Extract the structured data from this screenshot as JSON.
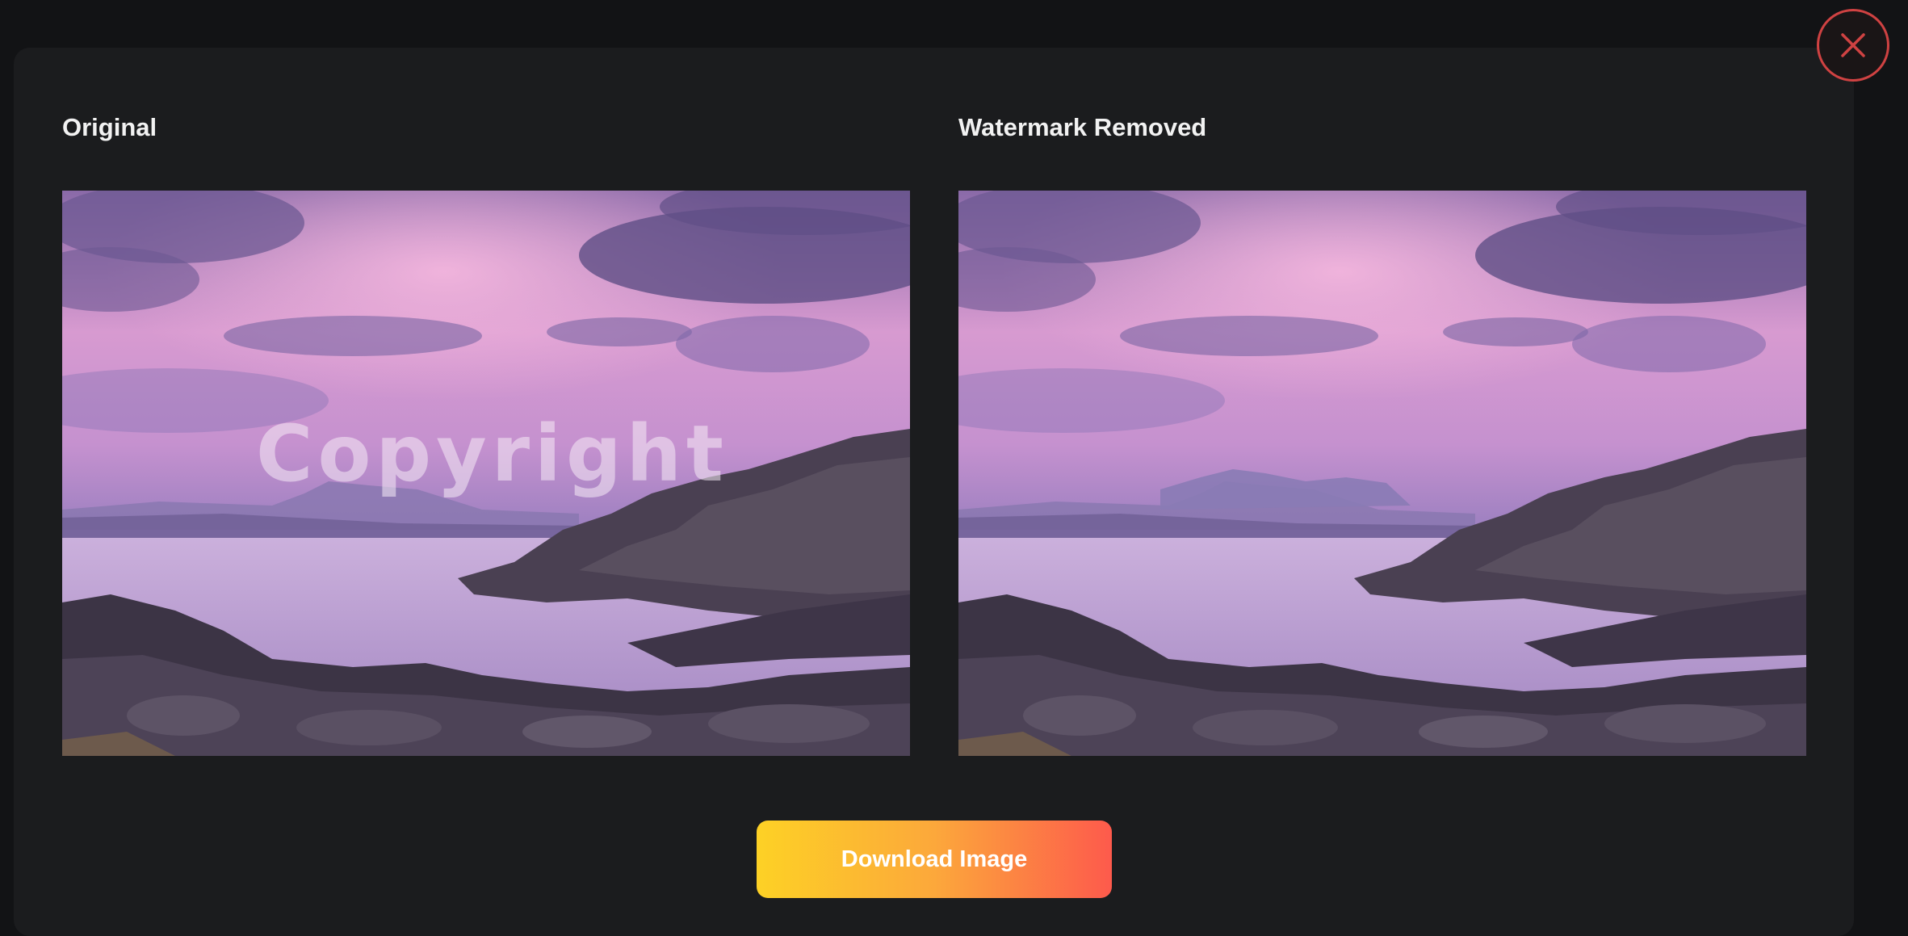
{
  "panels": [
    {
      "title": "Original",
      "image_alt": "Purple sunset seascape with rocky coastline",
      "watermark_text": "Copyright"
    },
    {
      "title": "Watermark Removed",
      "image_alt": "Purple sunset seascape with rocky coastline"
    }
  ],
  "actions": {
    "download_label": "Download Image"
  },
  "icons": {
    "close": "close-icon"
  },
  "colors": {
    "accent_red": "#cf4242",
    "download_gradient": [
      "#fdd125",
      "#fd5a4c"
    ]
  }
}
